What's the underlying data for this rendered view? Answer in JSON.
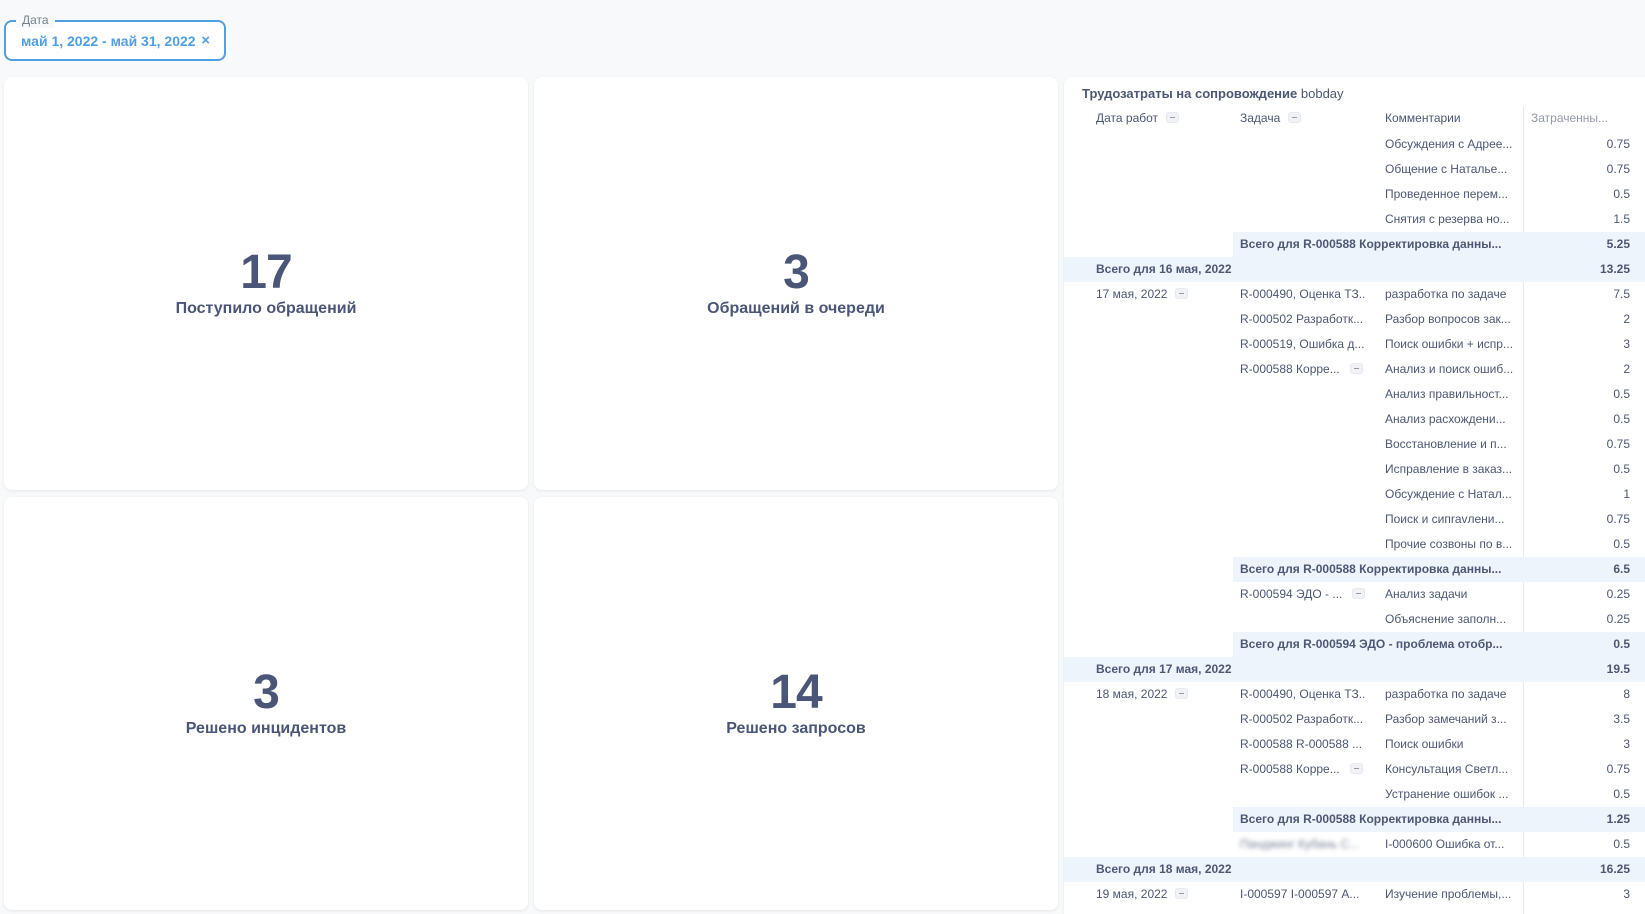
{
  "filter": {
    "label": "Дата",
    "value": "май 1, 2022 - май 31, 2022",
    "clear_icon": "×"
  },
  "cards": [
    {
      "value": "17",
      "label": "Поступило обращений"
    },
    {
      "value": "3",
      "label": "Обращений в очереди"
    },
    {
      "value": "3",
      "label": "Решено инцидентов"
    },
    {
      "value": "14",
      "label": "Решено запросов"
    }
  ],
  "table": {
    "title": "Трудозатраты на сопровождение",
    "user": "bobday",
    "columns": {
      "date": "Дата работ",
      "task": "Задача",
      "comment": "Комментарии",
      "spent": "Затраченны..."
    },
    "rows": [
      {
        "type": "row",
        "date": "",
        "task": "",
        "comment": "Обсуждения с Адрее...",
        "value": "0.75"
      },
      {
        "type": "row",
        "date": "",
        "task": "",
        "comment": "Общение с Наталье...",
        "value": "0.75"
      },
      {
        "type": "row",
        "date": "",
        "task": "",
        "comment": "Проведенное перем...",
        "value": "0.5"
      },
      {
        "type": "row",
        "date": "",
        "task": "",
        "comment": "Снятия с резерва но...",
        "value": "1.5"
      },
      {
        "type": "sub",
        "label": "Всего для R-000588 Корректировка данны...",
        "value": "5.25"
      },
      {
        "type": "tot",
        "label": "Всего для 16 мая, 2022",
        "value": "13.25"
      },
      {
        "type": "row",
        "date": "17 мая, 2022",
        "task": "R-000490, Оценка ТЗ...",
        "comment": "разработка по задаче",
        "value": "7.5"
      },
      {
        "type": "row",
        "date": "",
        "task": "R-000502 Разработк...",
        "comment": "Разбор вопросов зак...",
        "value": "2"
      },
      {
        "type": "row",
        "date": "",
        "task": "R-000519, Ошибка д...",
        "comment": "Поиск ошибки + испр...",
        "value": "3"
      },
      {
        "type": "row",
        "date": "",
        "task": "R-000588 Корре...",
        "task_collapse": true,
        "comment": "Анализ и поиск ошиб...",
        "value": "2"
      },
      {
        "type": "row",
        "date": "",
        "task": "",
        "comment": "Анализ правильност...",
        "value": "0.5"
      },
      {
        "type": "row",
        "date": "",
        "task": "",
        "comment": "Анализ расхождени...",
        "value": "0.5"
      },
      {
        "type": "row",
        "date": "",
        "task": "",
        "comment": "Восстановление и п...",
        "value": "0.75"
      },
      {
        "type": "row",
        "date": "",
        "task": "",
        "comment": "Исправление в заказ...",
        "value": "0.5"
      },
      {
        "type": "row",
        "date": "",
        "task": "",
        "comment": "Обсуждение с Натал...",
        "value": "1"
      },
      {
        "type": "row",
        "date": "",
        "task": "",
        "comment": "Поиск и сипravлени...",
        "value": "0.75"
      },
      {
        "type": "row",
        "date": "",
        "task": "",
        "comment": "Прочие созвоны по в...",
        "value": "0.5"
      },
      {
        "type": "sub",
        "label": "Всего для R-000588 Корректировка данны...",
        "value": "6.5"
      },
      {
        "type": "row",
        "date": "",
        "task": "R-000594 ЭДО - ...",
        "task_collapse": true,
        "comment": "Анализ задачи",
        "value": "0.25"
      },
      {
        "type": "row",
        "date": "",
        "task": "",
        "comment": "Объяснение заполн...",
        "value": "0.25"
      },
      {
        "type": "sub",
        "label": "Всего для R-000594 ЭДО - проблема отобр...",
        "value": "0.5"
      },
      {
        "type": "tot",
        "label": "Всего для 17 мая, 2022",
        "value": "19.5"
      },
      {
        "type": "row",
        "date": "18 мая, 2022",
        "task": "R-000490, Оценка ТЗ...",
        "comment": "разработка по задаче",
        "value": "8"
      },
      {
        "type": "row",
        "date": "",
        "task": "R-000502 Разработк...",
        "comment": "Разбор замечаний з...",
        "value": "3.5"
      },
      {
        "type": "row",
        "date": "",
        "task": "R-000588 R-000588 ...",
        "comment": "Поиск ошибки",
        "value": "3"
      },
      {
        "type": "row",
        "date": "",
        "task": "R-000588 Корре...",
        "task_collapse": true,
        "comment": "Консультация Светл...",
        "value": "0.75"
      },
      {
        "type": "row",
        "date": "",
        "task": "",
        "comment": "Устранение ошибок ...",
        "value": "0.5"
      },
      {
        "type": "sub",
        "label": "Всего для R-000588 Корректировка данны...",
        "value": "1.25"
      },
      {
        "type": "row",
        "date": "",
        "task": "Панджинг Кубань С...",
        "task_blurred": true,
        "comment": "I-000600 Ошибка от...",
        "value": "0.5"
      },
      {
        "type": "tot",
        "label": "Всего для 18 мая, 2022",
        "value": "16.25"
      },
      {
        "type": "row",
        "date": "19 мая, 2022",
        "task": "I-000597 I-000597 А...",
        "comment": "Изучение проблемы,...",
        "value": "3"
      }
    ]
  }
}
